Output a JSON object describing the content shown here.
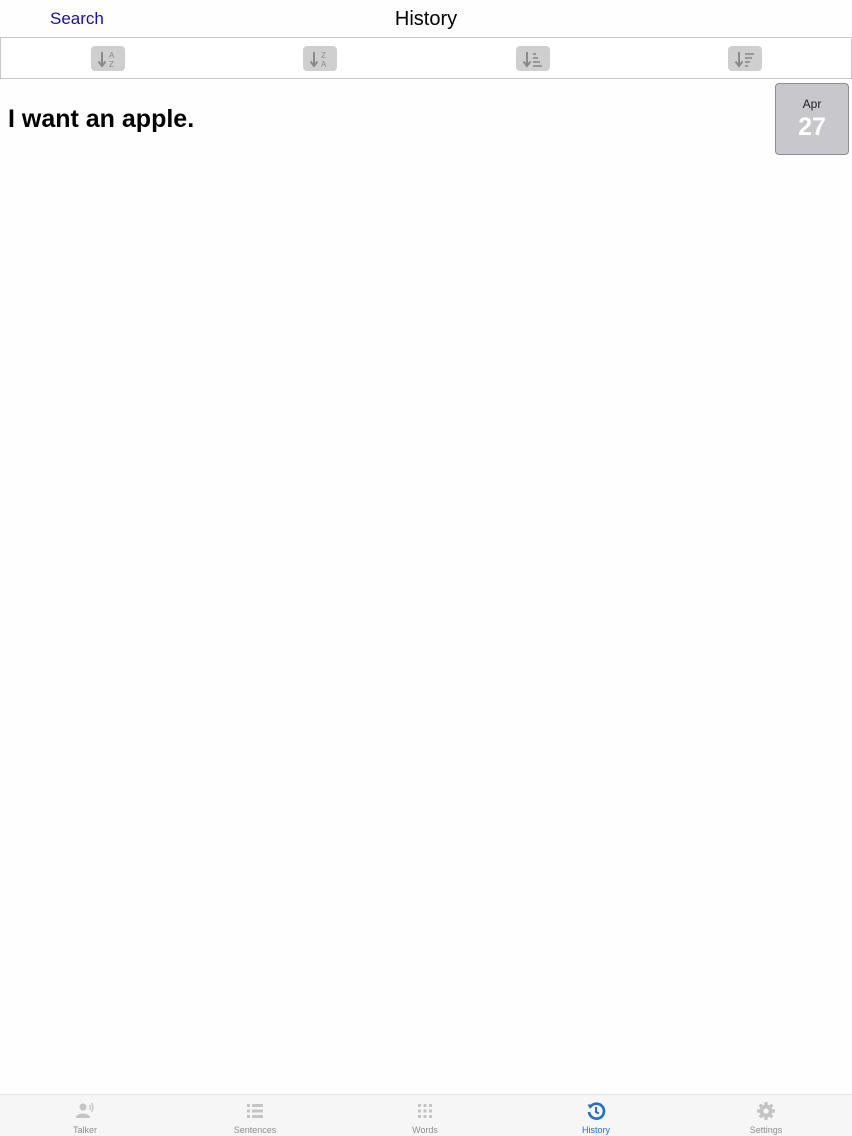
{
  "navbar": {
    "left_button": "Search",
    "title": "History"
  },
  "sortbar": {
    "buttons": [
      {
        "icon": "sort-alpha-asc-icon"
      },
      {
        "icon": "sort-alpha-desc-icon"
      },
      {
        "icon": "sort-length-asc-icon"
      },
      {
        "icon": "sort-length-desc-icon"
      }
    ]
  },
  "history": {
    "items": [
      {
        "text": "I want an apple.",
        "month": "Apr",
        "day": "27"
      }
    ]
  },
  "tabbar": {
    "tabs": [
      {
        "label": "Talker",
        "icon": "talker-icon",
        "active": false
      },
      {
        "label": "Sentences",
        "icon": "sentences-icon",
        "active": false
      },
      {
        "label": "Words",
        "icon": "words-icon",
        "active": false
      },
      {
        "label": "History",
        "icon": "history-icon",
        "active": true
      },
      {
        "label": "Settings",
        "icon": "settings-icon",
        "active": false
      }
    ]
  },
  "colors": {
    "link": "#1a0dab",
    "active_tab": "#1f6fd1",
    "inactive_tab": "#8e8e8e",
    "sort_button": "#cfcfcf",
    "date_badge": "#c8c8cc"
  }
}
